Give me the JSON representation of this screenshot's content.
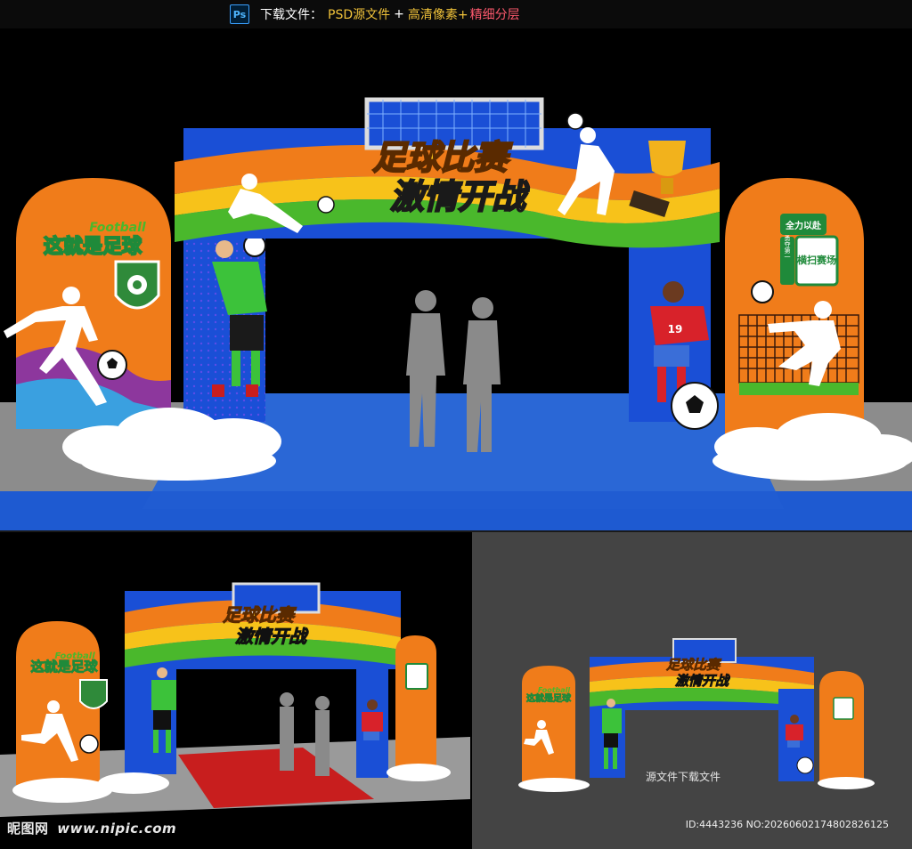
{
  "topbar": {
    "icon": "photoshop-icon",
    "icon_text": "Ps",
    "download_label": "下载文件：",
    "psd_label": "PSD源文件",
    "plus_1": "+",
    "hd_label": "高清像素+",
    "layers_label": "精细分层"
  },
  "arch": {
    "title_line1": "足球比赛",
    "title_line2": "激情开战",
    "left_word_en": "Football",
    "left_slogan": "这就是足球",
    "right_tag_top": "全力以赴",
    "right_tag_side": "勇夺第一",
    "right_tag_main": "横扫赛场",
    "jersey_number": "19"
  },
  "bottom_right": {
    "source_label": "源文件下载文件",
    "id_text": "ID:4443236 NO:20260602174802826125"
  },
  "bottom_left": {
    "watermark_cn": "昵图网",
    "watermark_site": "www.nipic.com"
  },
  "colors": {
    "orange": "#f07c1a",
    "blue": "#1a4fd6",
    "green": "#4ab82c",
    "yellow": "#f7c21a",
    "floor": "#2a67d6",
    "red_carpet": "#c81e1e"
  }
}
